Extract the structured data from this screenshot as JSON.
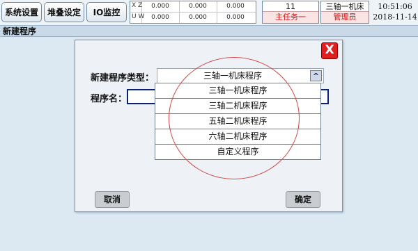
{
  "nav": {
    "system_settings": "系统设置",
    "stack_settings": "堆叠设定",
    "io_monitor": "IO监控"
  },
  "axes": {
    "row1_label": "X Z",
    "row2_label": "U W",
    "row1_values": [
      "0.000",
      "0.000",
      "0.000"
    ],
    "row2_values": [
      "0.000",
      "0.000",
      "0.000"
    ]
  },
  "task": {
    "number": "11",
    "label": "主任务一"
  },
  "machine": {
    "name": "三轴一机床",
    "role": "管理员"
  },
  "clock": {
    "time": "10:51:06",
    "date": "2018-11-14"
  },
  "page": {
    "title": "新建程序"
  },
  "dialog": {
    "close_icon": "X",
    "program_type_label": "新建程序类型：",
    "program_type_value": "三轴一机床程序",
    "program_name_label": "程序名：",
    "program_name_value": "",
    "dropdown_options": [
      "三轴一机床程序",
      "三轴二机床程序",
      "五轴二机床程序",
      "六轴二机床程序",
      "自定义程序"
    ],
    "cancel_label": "取消",
    "ok_label": "确定"
  },
  "colors": {
    "alert_red": "#d01010",
    "close_red": "#e02020",
    "annotation": "#d04848",
    "input_border": "#0c2078"
  }
}
